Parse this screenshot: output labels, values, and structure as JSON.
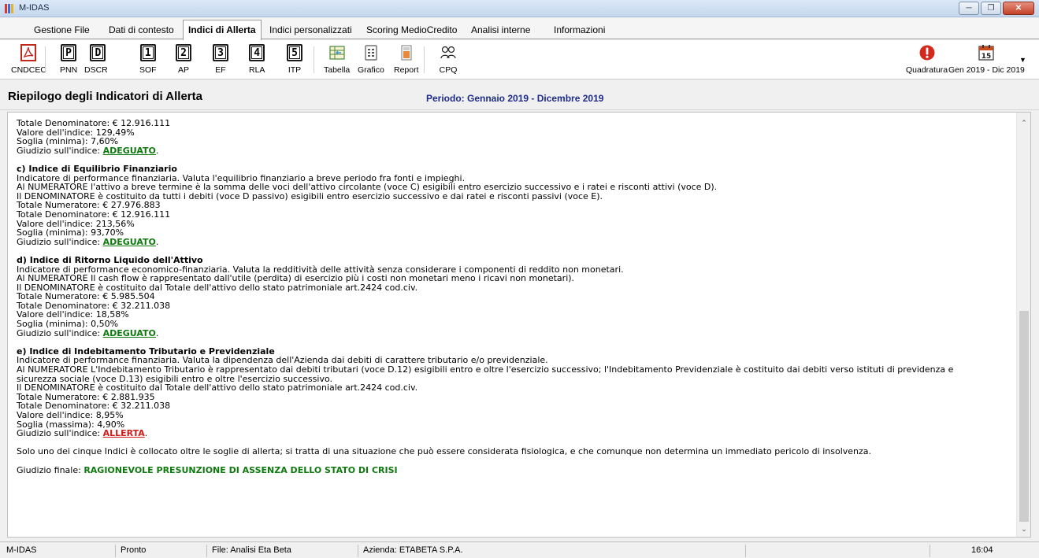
{
  "window": {
    "title": "M-IDAS"
  },
  "menu": {
    "items": [
      "Gestione File",
      "Dati di contesto",
      "Indici di Allerta",
      "Indici personalizzati",
      "Scoring MedioCredito",
      "Analisi interne",
      "Informazioni"
    ],
    "active": "Indici di Allerta"
  },
  "toolbar": {
    "buttons": [
      {
        "label": "CNDCEC",
        "icon": "pdf-icon"
      },
      {
        "label": "PNN",
        "glyph": "P"
      },
      {
        "label": "DSCR",
        "glyph": "D"
      },
      {
        "label": "SOF",
        "glyph": "1"
      },
      {
        "label": "AP",
        "glyph": "2"
      },
      {
        "label": "EF",
        "glyph": "3"
      },
      {
        "label": "RLA",
        "glyph": "4"
      },
      {
        "label": "ITP",
        "glyph": "5"
      },
      {
        "label": "Tabella",
        "icon": "table-icon"
      },
      {
        "label": "Grafico",
        "icon": "chart-icon"
      },
      {
        "label": "Report",
        "icon": "report-icon"
      },
      {
        "label": "CPQ",
        "icon": "people-icon"
      }
    ],
    "quadratura": {
      "label": "Quadratura",
      "icon": "alert-icon"
    },
    "period_button": {
      "label": "Gen 2019 - Dic 2019",
      "icon_number": "15"
    }
  },
  "header": {
    "title": "Riepilogo degli Indicatori di Allerta",
    "period": "Periodo: Gennaio 2019 - Dicembre 2019"
  },
  "report": {
    "intro_lines": [
      "Totale Denominatore: € 12.916.111",
      "Valore dell'indice: 129,49%",
      "Soglia (minima): 7,60%"
    ],
    "intro_giudizio": {
      "prefix": "Giudizio sull'indice: ",
      "value": "ADEGUATO",
      "suffix": "."
    },
    "sections": [
      {
        "title": "c) Indice di Equilibrio Finanziario",
        "lines": [
          "Indicatore di performance finanziaria. Valuta l'equilibrio finanziario a breve periodo fra fonti e impieghi.",
          "Al NUMERATORE l'attivo a breve termine è la somma delle voci dell'attivo circolante (voce C) esigibili entro esercizio successivo e i ratei e risconti attivi (voce D).",
          "Il DENOMINATORE è costituito da tutti i debiti (voce D passivo) esigibili entro esercizio successivo e dai ratei e risconti passivi (voce E).",
          "Totale Numeratore: € 27.976.883",
          "Totale Denominatore: € 12.916.111",
          "Valore dell'indice: 213,56%",
          "Soglia (minima): 93,70%"
        ],
        "giudizio_prefix": "Giudizio sull'indice: ",
        "giudizio": "ADEGUATO",
        "giudizio_suffix": "."
      },
      {
        "title": "d) Indice di Ritorno Liquido dell'Attivo",
        "lines": [
          "Indicatore di performance economico-finanziaria. Valuta la redditività delle attività senza considerare i componenti di reddito non monetari.",
          "Al NUMERATORE Il cash flow è rappresentato dall'utile (perdita) di esercizio più i costi non monetari meno i ricavi non monetari).",
          "Il DENOMINATORE è costituito dal Totale dell'attivo dello stato patrimoniale art.2424 cod.civ.",
          "Totale Numeratore: € 5.985.504",
          "Totale Denominatore: € 32.211.038",
          "Valore dell'indice: 18,58%",
          "Soglia (minima): 0,50%"
        ],
        "giudizio_prefix": "Giudizio sull'indice: ",
        "giudizio": "ADEGUATO",
        "giudizio_suffix": "."
      },
      {
        "title": "e) Indice di Indebitamento Tributario e Previdenziale",
        "lines": [
          "Indicatore di performance finanziaria. Valuta la dipendenza dell'Azienda dai debiti di carattere tributario e/o previdenziale.",
          "Al NUMERATORE L'Indebitamento Tributario è rappresentato dai debiti tributari (voce D.12) esigibili entro e oltre l'esercizio successivo; l'Indebitamento Previdenziale è costituito dai debiti verso istituti di previdenza e",
          "sicurezza sociale (voce D.13) esigibili entro e oltre l'esercizio successivo.",
          "Il DENOMINATORE è costituito dal Totale dell'attivo dello stato patrimoniale art.2424 cod.civ.",
          "Totale Numeratore: € 2.881.935",
          "Totale Denominatore: € 32.211.038",
          "Valore dell'indice: 8,95%",
          "Soglia (massima): 4,90%"
        ],
        "giudizio_prefix": "Giudizio sull'indice: ",
        "giudizio": "ALLERTA",
        "giudizio_suffix": "."
      }
    ],
    "summary": "Solo uno dei cinque Indici è collocato oltre le soglie di allerta; si tratta di una situazione che può essere considerata fisiologica, e che comunque non determina un immediato pericolo di insolvenza.",
    "final_prefix": "Giudizio finale: ",
    "final_value": "RAGIONEVOLE PRESUNZIONE DI ASSENZA DELLO STATO DI CRISI"
  },
  "status": {
    "app": "M-IDAS",
    "state": "Pronto",
    "file": "File: Analisi Eta Beta",
    "azienda": "Azienda: ETABETA S.P.A.",
    "time": "16:04"
  },
  "colors": {
    "ok": "#0e7a0e",
    "alert": "#d11b1b",
    "period": "#1d2c8c"
  }
}
